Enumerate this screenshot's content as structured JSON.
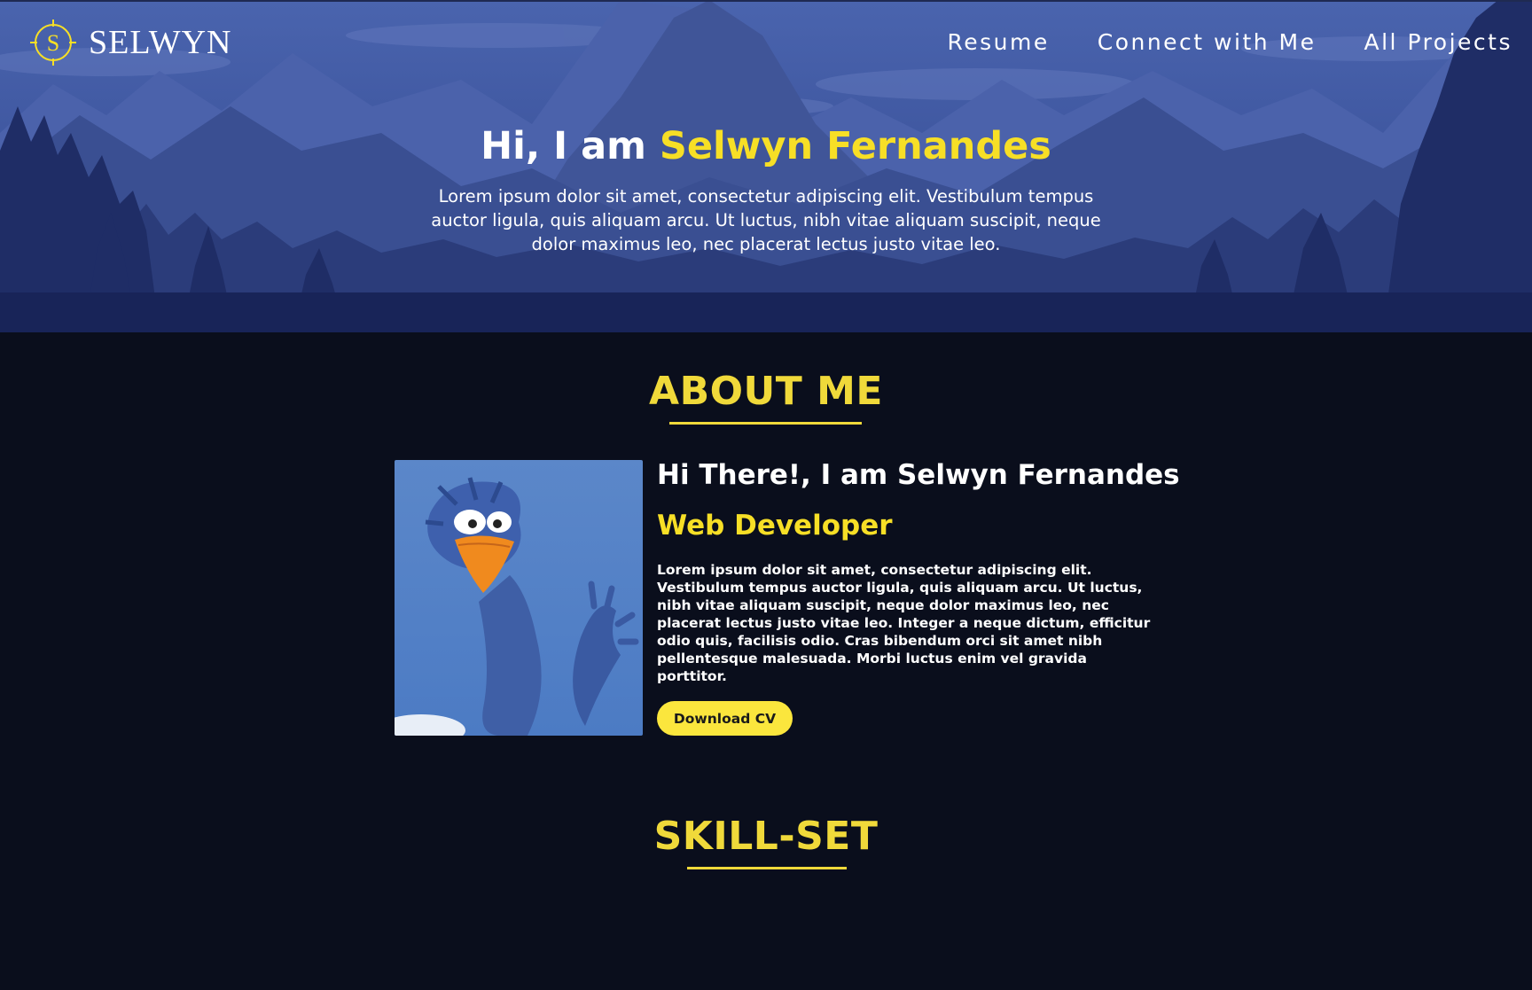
{
  "brand": {
    "name": "SELWYN",
    "logo_icon": "s-crosshair-logo-icon",
    "accent": "#f7df26"
  },
  "nav": {
    "items": [
      "Resume",
      "Connect with Me",
      "All Projects"
    ]
  },
  "hero": {
    "greeting": "Hi, I am ",
    "name": "Selwyn Fernandes",
    "text": "Lorem ipsum dolor sit amet, consectetur adipiscing elit. Vestibulum tempus auctor ligula, quis aliquam arcu. Ut luctus, nibh vitae aliquam suscipit, neque dolor maximus leo, nec placerat lectus justo vitae leo."
  },
  "about": {
    "title": "ABOUT ME",
    "heading": "Hi There!, I am Selwyn Fernandes",
    "role": "Web Developer",
    "text": "Lorem ipsum dolor sit amet, consectetur adipiscing elit. Vestibulum tempus auctor ligula, quis aliquam arcu. Ut luctus, nibh vitae aliquam suscipit, neque dolor maximus leo, nec placerat lectus justo vitae leo. Integer a neque dictum, efficitur odio quis, facilisis odio. Cras bibendum orci sit amet nibh pellentesque malesuada. Morbi luctus enim vel gravida porttitor.",
    "cv_button": "Download CV"
  },
  "skills": {
    "title": "SKILL-SET"
  },
  "colors": {
    "background": "#0a0e1c",
    "accent_yellow": "#f7df26",
    "button_yellow": "#fbe63d",
    "hero_blue": "#4a64ae"
  }
}
